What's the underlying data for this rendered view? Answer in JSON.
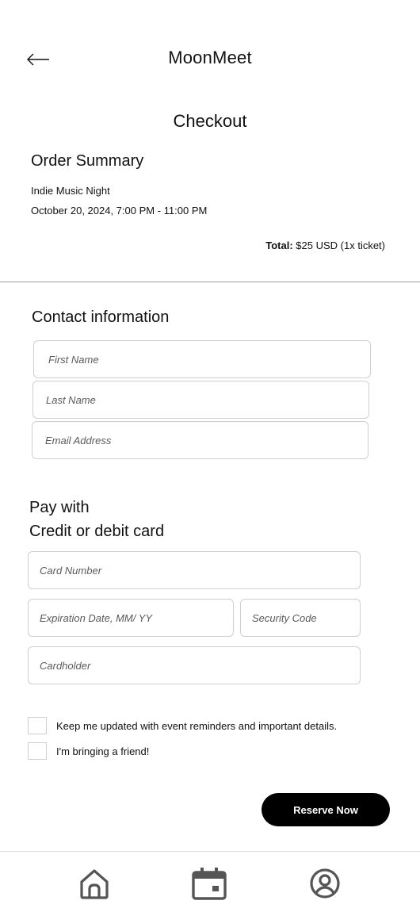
{
  "header": {
    "back_icon": "arrow-left-icon",
    "app_title": "MoonMeet"
  },
  "page_title": "Checkout",
  "order_summary": {
    "heading": "Order Summary",
    "event_name": "Indie Music Night",
    "event_datetime": "October 20, 2024, 7:00 PM - 11:00 PM",
    "total_label": "Total:",
    "total_value": "$25 USD (1x ticket)"
  },
  "contact": {
    "heading": "Contact information",
    "first_name_placeholder": "First Name",
    "last_name_placeholder": "Last Name",
    "email_placeholder": "Email Address"
  },
  "payment": {
    "heading_line1": "Pay with",
    "heading_line2": "Credit or debit card",
    "card_number_placeholder": "Card Number",
    "expiration_placeholder": "Expiration Date, MM/ YY",
    "security_code_placeholder": "Security Code",
    "cardholder_placeholder": "Cardholder"
  },
  "options": {
    "updates_label": "Keep me updated with event reminders and important details.",
    "friend_label": "I'm bringing a friend!"
  },
  "reserve_label": "Reserve Now",
  "bottom_nav": {
    "items": [
      {
        "icon": "home-icon"
      },
      {
        "icon": "calendar-icon"
      },
      {
        "icon": "profile-icon"
      }
    ]
  },
  "colors": {
    "text": "#111111",
    "button_bg": "#000000",
    "button_text": "#ffffff",
    "field_border": "#cfcfcf",
    "icon": "#555555"
  }
}
